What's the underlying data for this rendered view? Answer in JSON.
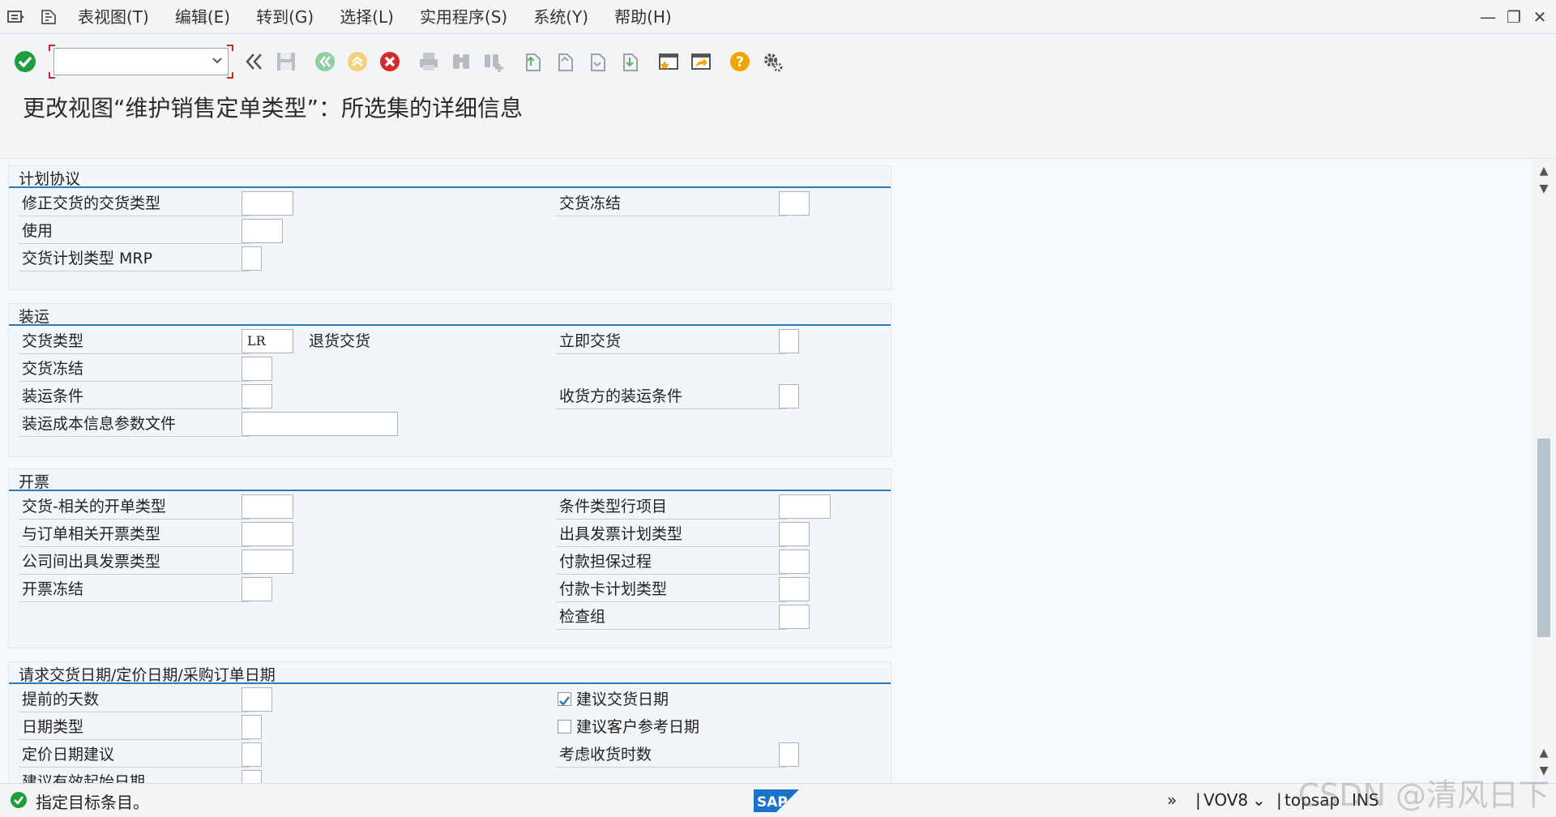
{
  "menubar": {
    "items": [
      "表视图(T)",
      "编辑(E)",
      "转到(G)",
      "选择(L)",
      "实用程序(S)",
      "系统(Y)",
      "帮助(H)"
    ]
  },
  "toolbar": {
    "command_value": "",
    "icons": [
      "check-icon",
      "back-double-icon",
      "save-icon",
      "back-icon",
      "exit-icon",
      "cancel-icon",
      "print-icon",
      "find-icon",
      "find-next-icon",
      "first-page-icon",
      "prev-page-icon",
      "next-page-icon",
      "last-page-icon",
      "new-session-icon",
      "shortcut-icon",
      "help-icon",
      "settings-icon"
    ]
  },
  "title": "更改视图“维护销售定单类型”：所选集的详细信息",
  "groups": {
    "schedule": {
      "title": "计划协议",
      "left": [
        {
          "label": "修正交货的交货类型",
          "value": ""
        },
        {
          "label": "使用",
          "value": ""
        },
        {
          "label": "交货计划类型 MRP",
          "value": ""
        }
      ],
      "right": [
        {
          "label": "交货冻结",
          "value": ""
        }
      ]
    },
    "shipping": {
      "title": "装运",
      "left": [
        {
          "label": "交货类型",
          "value": "LR",
          "desc": "退货交货"
        },
        {
          "label": "交货冻结",
          "value": ""
        },
        {
          "label": "装运条件",
          "value": ""
        },
        {
          "label": "装运成本信息参数文件",
          "value": ""
        }
      ],
      "right": [
        {
          "label": "立即交货",
          "value": ""
        },
        {
          "label": "收货方的装运条件",
          "value": ""
        }
      ]
    },
    "billing": {
      "title": "开票",
      "left": [
        {
          "label": "交货-相关的开单类型",
          "value": ""
        },
        {
          "label": "与订单相关开票类型",
          "value": ""
        },
        {
          "label": "公司间出具发票类型",
          "value": ""
        },
        {
          "label": "开票冻结",
          "value": ""
        }
      ],
      "right": [
        {
          "label": "条件类型行项目",
          "value": ""
        },
        {
          "label": "出具发票计划类型",
          "value": ""
        },
        {
          "label": "付款担保过程",
          "value": ""
        },
        {
          "label": "付款卡计划类型",
          "value": ""
        },
        {
          "label": "检查组",
          "value": ""
        }
      ]
    },
    "dates": {
      "title": "请求交货日期/定价日期/采购订单日期",
      "left": [
        {
          "label": "提前的天数",
          "value": ""
        },
        {
          "label": "日期类型",
          "value": ""
        },
        {
          "label": "定价日期建议",
          "value": ""
        },
        {
          "label": "建议有效起始日期",
          "value": ""
        }
      ],
      "right": [
        {
          "label": "建议交货日期",
          "checked": true
        },
        {
          "label": "建议客户参考日期",
          "checked": false
        },
        {
          "label": "考虑收货时数",
          "value": ""
        }
      ]
    }
  },
  "statusbar": {
    "message": "指定目标条目。",
    "transaction": "VOV8",
    "system": "topsap",
    "mode": "INS"
  },
  "watermark": "CSDN @清风日下",
  "colors": {
    "accent": "#2a7ab8",
    "ok_green": "#1e9e3a",
    "cancel_red": "#d42a2a",
    "help_orange": "#f0a500"
  }
}
